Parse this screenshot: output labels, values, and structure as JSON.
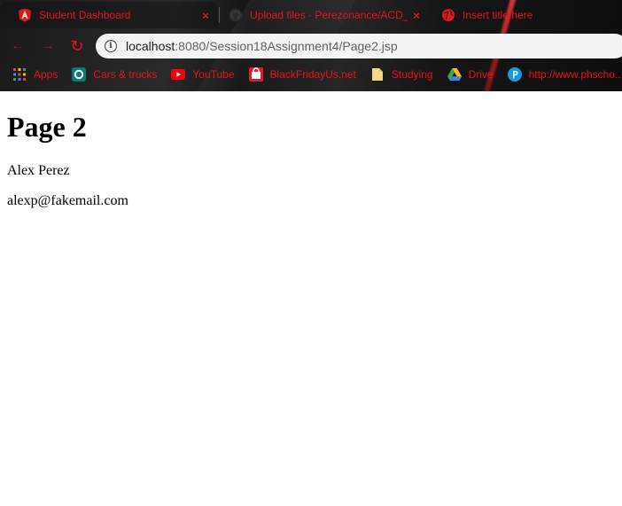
{
  "browser": {
    "tabs": [
      {
        "title": "Student Dashboard",
        "favicon": "angular-icon",
        "active": true
      },
      {
        "title": "Upload files · Perezonance/ACD_",
        "favicon": "github-icon",
        "active": false
      },
      {
        "title": "Insert title here",
        "favicon": "globe-icon",
        "active": false
      }
    ],
    "tab_close_glyph": "×",
    "nav": {
      "back": "←",
      "forward": "→",
      "reload": "↻"
    },
    "address": {
      "host": "localhost",
      "path": ":8080/Session18Assignment4/Page2.jsp",
      "info_glyph": "i"
    },
    "bookmarks": [
      {
        "label": "Apps",
        "icon": "apps-grid-icon"
      },
      {
        "label": "Cars & trucks",
        "icon": "cars-icon"
      },
      {
        "label": "YouTube",
        "icon": "youtube-icon"
      },
      {
        "label": "BlackFridayUs.net",
        "icon": "blackfriday-icon"
      },
      {
        "label": "Studying",
        "icon": "folder-icon"
      },
      {
        "label": "Drive",
        "icon": "drive-icon"
      },
      {
        "label": "http://www.phscho...",
        "icon": "pearson-icon"
      }
    ],
    "accent_color": "#e8141c"
  },
  "page": {
    "heading": "Page 2",
    "name": "Alex Perez",
    "email": "alexp@fakemail.com"
  }
}
